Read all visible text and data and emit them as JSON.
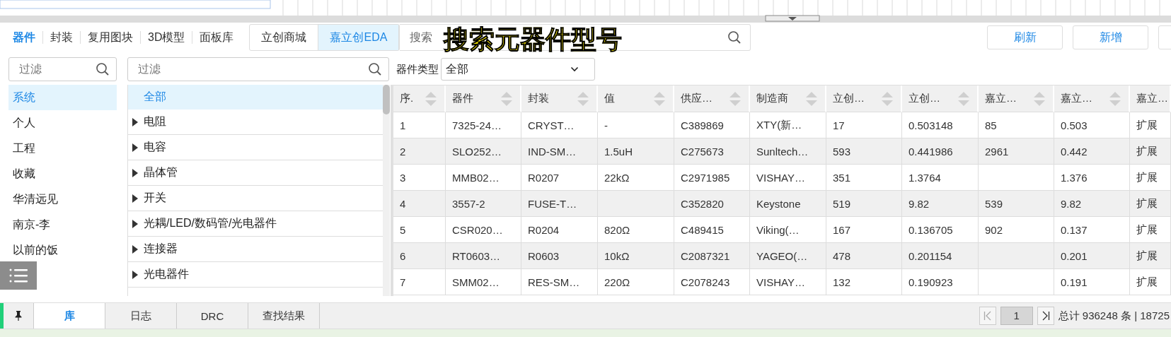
{
  "top_tabs": [
    {
      "label": "器件",
      "selected": true
    },
    {
      "label": "封装",
      "selected": false
    },
    {
      "label": "复用图块",
      "selected": false
    },
    {
      "label": "3D模型",
      "selected": false
    },
    {
      "label": "面板库",
      "selected": false
    }
  ],
  "source_tabs": [
    {
      "label": "立创商城",
      "selected": false
    },
    {
      "label": "嘉立创EDA",
      "selected": true
    }
  ],
  "search": {
    "placeholder": "搜索"
  },
  "annotation": "搜索元器件型号",
  "buttons": [
    "刷新",
    "新增"
  ],
  "library_filter": {
    "placeholder": "过滤"
  },
  "library_list": [
    {
      "label": "系统",
      "selected": true
    },
    {
      "label": "个人",
      "selected": false
    },
    {
      "label": "工程",
      "selected": false
    },
    {
      "label": "收藏",
      "selected": false
    },
    {
      "label": "华清远见",
      "selected": false
    },
    {
      "label": "南京-李",
      "selected": false
    },
    {
      "label": "以前的饭",
      "selected": false
    }
  ],
  "category_filter": {
    "placeholder": "过滤"
  },
  "category_type": {
    "label": "器件类型",
    "value": "全部"
  },
  "categories": [
    {
      "label": "全部",
      "selected": true,
      "expandable": false
    },
    {
      "label": "电阻",
      "selected": false,
      "expandable": true
    },
    {
      "label": "电容",
      "selected": false,
      "expandable": true
    },
    {
      "label": "晶体管",
      "selected": false,
      "expandable": true
    },
    {
      "label": "开关",
      "selected": false,
      "expandable": true
    },
    {
      "label": "光耦/LED/数码管/光电器件",
      "selected": false,
      "expandable": true
    },
    {
      "label": "连接器",
      "selected": false,
      "expandable": true
    },
    {
      "label": "光电器件",
      "selected": false,
      "expandable": true
    }
  ],
  "table": {
    "columns": [
      "序.",
      "器件",
      "封装",
      "值",
      "供应…",
      "制造商",
      "立创…",
      "立创…",
      "嘉立…",
      "嘉立…",
      "嘉立…"
    ],
    "rows": [
      [
        "1",
        "7325-24…",
        "CRYST…",
        "-",
        "C389869",
        "XTY(新…",
        "17",
        "0.503148",
        "85",
        "0.503",
        "扩展"
      ],
      [
        "2",
        "SLO252…",
        "IND-SM…",
        "1.5uH",
        "C275673",
        "Sunltech…",
        "593",
        "0.441986",
        "2961",
        "0.442",
        "扩展"
      ],
      [
        "3",
        "MMB02…",
        "R0207",
        "22kΩ",
        "C2971985",
        "VISHAY…",
        "351",
        "1.3764",
        null,
        "1.376",
        "扩展"
      ],
      [
        "4",
        "3557-2",
        "FUSE-T…",
        null,
        "C352820",
        "Keystone",
        "519",
        "9.82",
        "539",
        "9.82",
        "扩展"
      ],
      [
        "5",
        "CSR020…",
        "R0204",
        "820Ω",
        "C489415",
        "Viking(…",
        "167",
        "0.136705",
        "902",
        "0.137",
        "扩展"
      ],
      [
        "6",
        "RT0603…",
        "R0603",
        "10kΩ",
        "C2087321",
        "YAGEO(…",
        "478",
        "0.201154",
        null,
        "0.201",
        "扩展"
      ],
      [
        "7",
        "SMM02…",
        "RES-SM…",
        "220Ω",
        "C2078243",
        "VISHAY…",
        "132",
        "0.190923",
        null,
        "0.191",
        "扩展"
      ]
    ]
  },
  "bottom_tabs": [
    {
      "label": "库",
      "selected": true
    },
    {
      "label": "日志",
      "selected": false
    },
    {
      "label": "DRC",
      "selected": false
    },
    {
      "label": "查找结果",
      "selected": false
    }
  ],
  "pager": {
    "page": "1",
    "total": "总计 936248 条 | 18725"
  }
}
